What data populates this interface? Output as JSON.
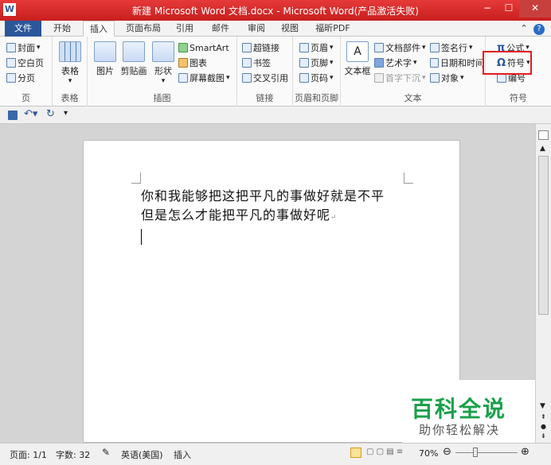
{
  "window": {
    "title": "新建 Microsoft Word 文档.docx - Microsoft Word(产品激活失败)",
    "app_icon": "W",
    "minimize": "−",
    "maximize": "☐",
    "close": "✕"
  },
  "tabs": [
    {
      "label": "文件"
    },
    {
      "label": "开始"
    },
    {
      "label": "插入"
    },
    {
      "label": "页面布局"
    },
    {
      "label": "引用"
    },
    {
      "label": "邮件"
    },
    {
      "label": "审阅"
    },
    {
      "label": "视图"
    },
    {
      "label": "福昕PDF"
    }
  ],
  "ribbon": {
    "pages": {
      "label": "页",
      "items": [
        "封面",
        "空白页",
        "分页"
      ]
    },
    "tables": {
      "label": "表格",
      "button": "表格"
    },
    "illustrations": {
      "label": "插图",
      "picture": "图片",
      "clipart": "剪贴画",
      "shapes": "形状",
      "smartart": "SmartArt",
      "chart": "图表",
      "screenshot": "屏幕截图"
    },
    "links": {
      "label": "链接",
      "items": [
        "超链接",
        "书签",
        "交叉引用"
      ]
    },
    "header_footer": {
      "label": "页眉和页脚",
      "items": [
        "页眉",
        "页脚",
        "页码"
      ]
    },
    "text": {
      "label": "文本",
      "textbox": "文本框",
      "parts": "文档部件",
      "wordart": "艺术字",
      "dropcap": "首字下沉",
      "signature": "签名行",
      "datetime": "日期和时间",
      "object": "对象"
    },
    "symbols": {
      "label": "符号",
      "equation": "公式",
      "symbol": "符号",
      "number": "编号"
    }
  },
  "document": {
    "line1": "你和我能够把这把平凡的事做好就是不平",
    "line2": "但是怎么才能把平凡的事做好呢"
  },
  "status": {
    "page": "页面: 1/1",
    "words": "字数: 32",
    "language": "英语(美国)",
    "mode": "插入",
    "zoom": "70%"
  },
  "watermark": {
    "title": "百科全说",
    "subtitle": "助你轻松解决"
  },
  "colors": {
    "title_bar": "#d52b2b",
    "file_tab": "#2b579a",
    "highlight": "#e51c1c",
    "watermark": "#1aa04a"
  }
}
